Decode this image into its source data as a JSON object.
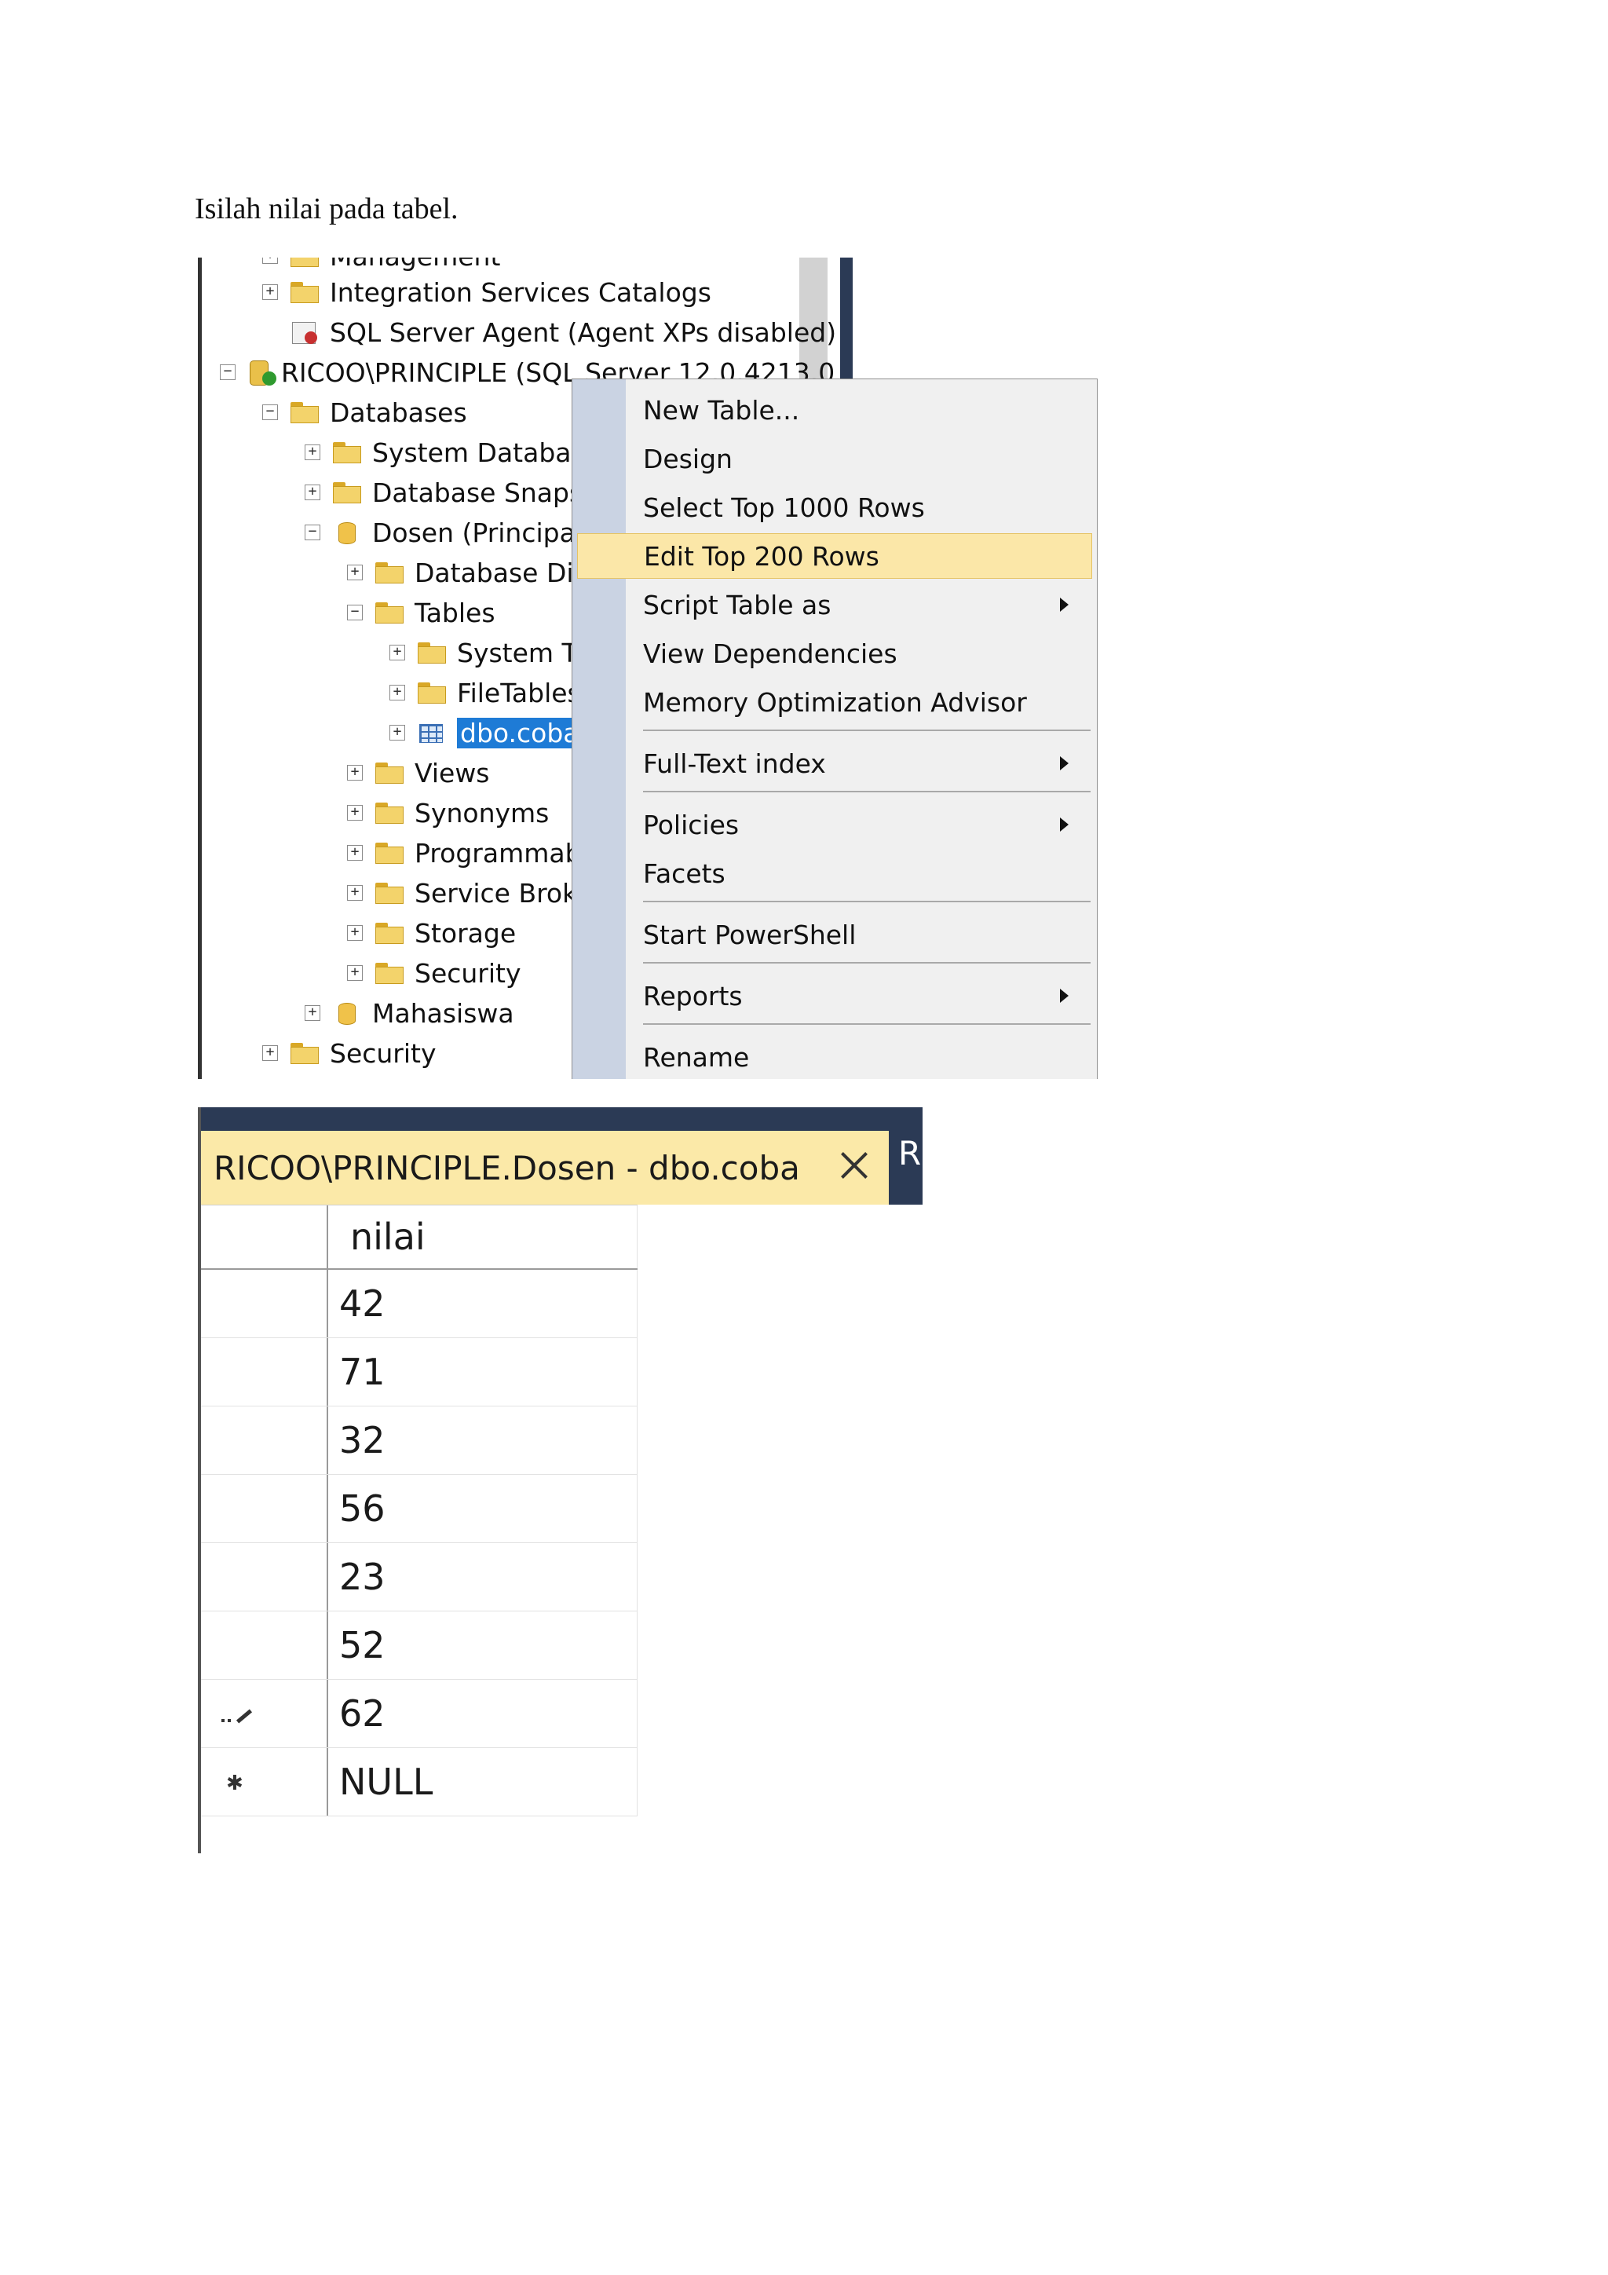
{
  "instruction": "Isilah nilai pada tabel.",
  "object_explorer": {
    "items": [
      {
        "label": "Management",
        "toggle": "+",
        "icon": "folder-icon"
      },
      {
        "label": "Integration Services Catalogs",
        "toggle": "+",
        "icon": "folder-icon"
      },
      {
        "label": "SQL Server Agent (Agent XPs disabled)",
        "toggle": "",
        "icon": "agent-icon"
      },
      {
        "label": "RICOO\\PRINCIPLE (SQL Server 12.0.4213.0",
        "toggle": "−",
        "icon": "server-icon"
      },
      {
        "label": "Databases",
        "toggle": "−",
        "icon": "folder-icon"
      },
      {
        "label": "System Databases",
        "toggle": "+",
        "icon": "folder-icon"
      },
      {
        "label": "Database Snapshots",
        "toggle": "+",
        "icon": "folder-icon"
      },
      {
        "label": "Dosen (Principal)",
        "toggle": "−",
        "icon": "database-icon"
      },
      {
        "label": "Database Diagrams",
        "toggle": "+",
        "icon": "folder-icon"
      },
      {
        "label": "Tables",
        "toggle": "−",
        "icon": "folder-icon"
      },
      {
        "label": "System Tables",
        "toggle": "+",
        "icon": "folder-icon"
      },
      {
        "label": "FileTables",
        "toggle": "+",
        "icon": "folder-icon"
      },
      {
        "label": "dbo.coba",
        "toggle": "+",
        "icon": "table-icon",
        "selected": true
      },
      {
        "label": "Views",
        "toggle": "+",
        "icon": "folder-icon"
      },
      {
        "label": "Synonyms",
        "toggle": "+",
        "icon": "folder-icon"
      },
      {
        "label": "Programmability",
        "toggle": "+",
        "icon": "folder-icon"
      },
      {
        "label": "Service Broker",
        "toggle": "+",
        "icon": "folder-icon"
      },
      {
        "label": "Storage",
        "toggle": "+",
        "icon": "folder-icon"
      },
      {
        "label": "Security",
        "toggle": "+",
        "icon": "folder-icon"
      },
      {
        "label": "Mahasiswa",
        "toggle": "+",
        "icon": "database-icon"
      },
      {
        "label": "Security",
        "toggle": "+",
        "icon": "folder-icon"
      }
    ]
  },
  "context_menu": {
    "items": [
      {
        "label": "New Table...",
        "submenu": false
      },
      {
        "label": "Design",
        "submenu": false
      },
      {
        "label": "Select Top 1000 Rows",
        "submenu": false
      },
      {
        "label": "Edit Top 200 Rows",
        "submenu": false,
        "highlighted": true
      },
      {
        "label": "Script Table as",
        "submenu": true
      },
      {
        "label": "View Dependencies",
        "submenu": false
      },
      {
        "label": "Memory Optimization Advisor",
        "submenu": false
      },
      {
        "label": "Full-Text index",
        "submenu": true
      },
      {
        "label": "Policies",
        "submenu": true
      },
      {
        "label": "Facets",
        "submenu": false
      },
      {
        "label": "Start PowerShell",
        "submenu": false
      },
      {
        "label": "Reports",
        "submenu": true
      },
      {
        "label": "Rename",
        "submenu": false
      }
    ]
  },
  "editor": {
    "tab_title": "RICOO\\PRINCIPLE.Dosen - dbo.coba",
    "next_tab_label": "R",
    "column_header": "nilai",
    "rows": [
      "42",
      "71",
      "32",
      "56",
      "23",
      "52",
      "62",
      "NULL"
    ],
    "row_markers": [
      "",
      "",
      "",
      "",
      "",
      "",
      "pencil-icon",
      "asterisk-icon"
    ]
  },
  "colors": {
    "selection": "#1e7bd6",
    "menu_highlight": "#fbe7a8",
    "tab_background": "#fbe9a8",
    "tab_bar": "#2b3a55"
  }
}
